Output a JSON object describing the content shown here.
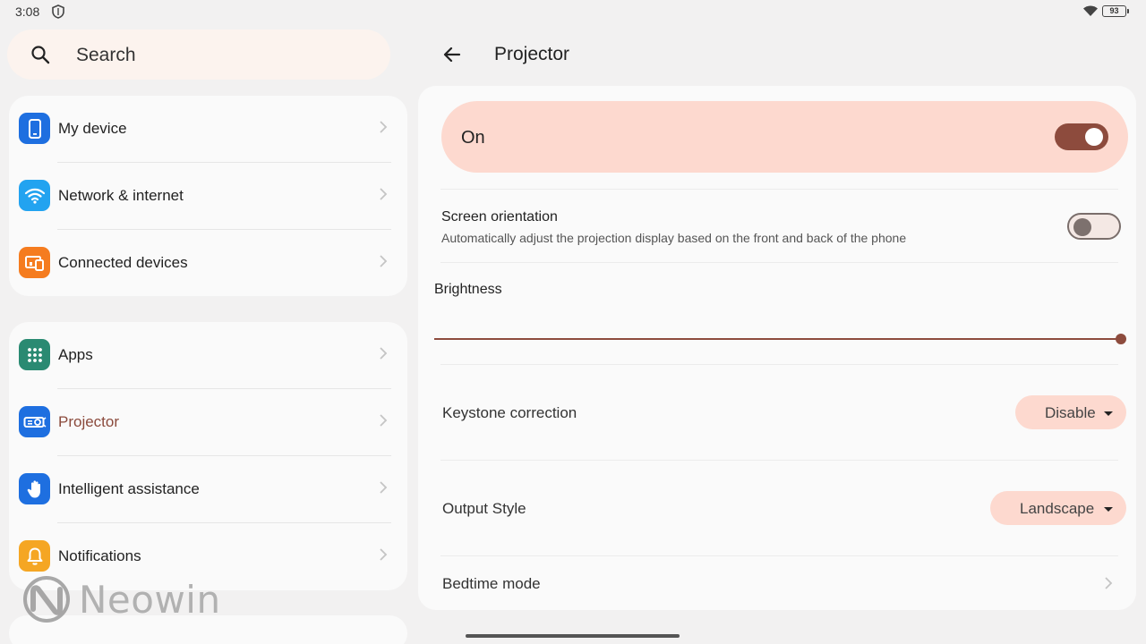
{
  "status_bar": {
    "time": "3:08",
    "battery": "93",
    "icons": [
      "shield-icon",
      "wifi-icon",
      "battery-icon"
    ]
  },
  "search": {
    "placeholder": "Search"
  },
  "sidebar": {
    "group1": [
      {
        "label": "My device",
        "icon": "phone-icon",
        "color": "#1e6fe0"
      },
      {
        "label": "Network & internet",
        "icon": "wifi-icon",
        "color": "#22a3f0"
      },
      {
        "label": "Connected devices",
        "icon": "devices-icon",
        "color": "#f57c1f"
      }
    ],
    "group2": [
      {
        "label": "Apps",
        "icon": "apps-grid-icon",
        "color": "#2a8a72"
      },
      {
        "label": "Projector",
        "icon": "projector-icon",
        "color": "#1e6fe0",
        "active": true
      },
      {
        "label": "Intelligent assistance",
        "icon": "hand-icon",
        "color": "#1e6fe0"
      },
      {
        "label": "Notifications",
        "icon": "bell-icon",
        "color": "#f5a623"
      }
    ]
  },
  "watermark": {
    "text": "Neowin"
  },
  "header": {
    "title": "Projector"
  },
  "settings": {
    "master": {
      "label": "On",
      "enabled": true
    },
    "screen_orientation": {
      "title": "Screen orientation",
      "description": "Automatically adjust the projection display based on the front and back of the phone",
      "enabled": false
    },
    "brightness": {
      "label": "Brightness",
      "value_fraction": 1.0
    },
    "keystone": {
      "label": "Keystone correction",
      "value": "Disable"
    },
    "output_style": {
      "label": "Output Style",
      "value": "Landscape"
    },
    "bedtime": {
      "label": "Bedtime mode"
    }
  },
  "colors": {
    "accent": "#8d4b3d",
    "accent_container": "#fdd9cf",
    "background": "#f2f1f1",
    "surface": "#fafafa"
  }
}
